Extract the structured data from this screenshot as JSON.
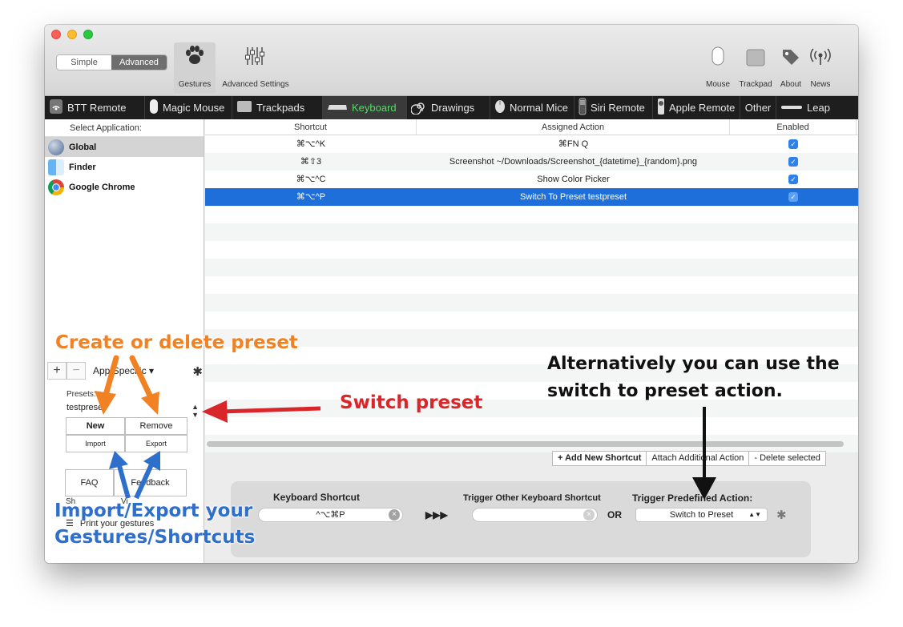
{
  "toolbar": {
    "mode_simple": "Simple",
    "mode_advanced": "Advanced",
    "gestures": "Gestures",
    "advanced_settings": "Advanced Settings",
    "mouse": "Mouse",
    "trackpad": "Trackpad",
    "about": "About",
    "news": "News"
  },
  "tabs": [
    "BTT Remote",
    "Magic Mouse",
    "Trackpads",
    "Keyboard",
    "Drawings",
    "Normal Mice",
    "Siri Remote",
    "Apple Remote",
    "Other",
    "Leap"
  ],
  "sidebar": {
    "header": "Select Application:",
    "apps": [
      "Global",
      "Finder",
      "Google Chrome"
    ],
    "plus": "+",
    "minus": "−",
    "app_specific": "App Specific ▾",
    "presets_label": "Presets:",
    "preset_value": "testpreset",
    "new": "New",
    "remove": "Remove",
    "import": "Import",
    "export": "Export",
    "faq": "FAQ",
    "feedback": "Feedback",
    "show_prefix": "Sh",
    "show_suffix": "Vi",
    "print": "Print your gestures"
  },
  "table": {
    "headers": [
      "Shortcut",
      "Assigned Action",
      "Enabled"
    ],
    "rows": [
      {
        "shortcut": "⌘⌥^K",
        "action": "⌘FN Q",
        "enabled": "✓"
      },
      {
        "shortcut": "⌘⇧3",
        "action": "Screenshot ~/Downloads/Screenshot_{datetime}_{random}.png",
        "enabled": "✓"
      },
      {
        "shortcut": "⌘⌥^C",
        "action": "Show Color Picker",
        "enabled": "✓"
      },
      {
        "shortcut": "⌘⌥^P",
        "action": "Switch To Preset testpreset",
        "enabled": "✓"
      }
    ]
  },
  "actions": {
    "add": "+ Add New Shortcut",
    "attach": "Attach Additional Action",
    "delete": "- Delete selected"
  },
  "editor": {
    "keyboard_shortcut_label": "Keyboard Shortcut",
    "keyboard_shortcut_value": "^⌥⌘P",
    "arrows": "▶▶▶",
    "trigger_other_label": "Trigger Other Keyboard Shortcut",
    "or": "OR",
    "trigger_predefined_label": "Trigger Predefined Action:",
    "predefined_value": "Switch to Preset",
    "clear": "×"
  },
  "annotations": {
    "create_delete": "Create or delete preset",
    "switch_preset": "Switch preset",
    "alternatively_1": "Alternatively you can use the",
    "alternatively_2": "switch to preset action.",
    "import_export_1": "Import/Export your",
    "import_export_2": "Gestures/Shortcuts"
  },
  "colors": {
    "selection_blue": "#1e6fd9",
    "keyboard_tab_green": "#59d76b",
    "annotation_orange": "#f08224",
    "annotation_red": "#d9262a",
    "annotation_blue": "#2f6fcc"
  }
}
